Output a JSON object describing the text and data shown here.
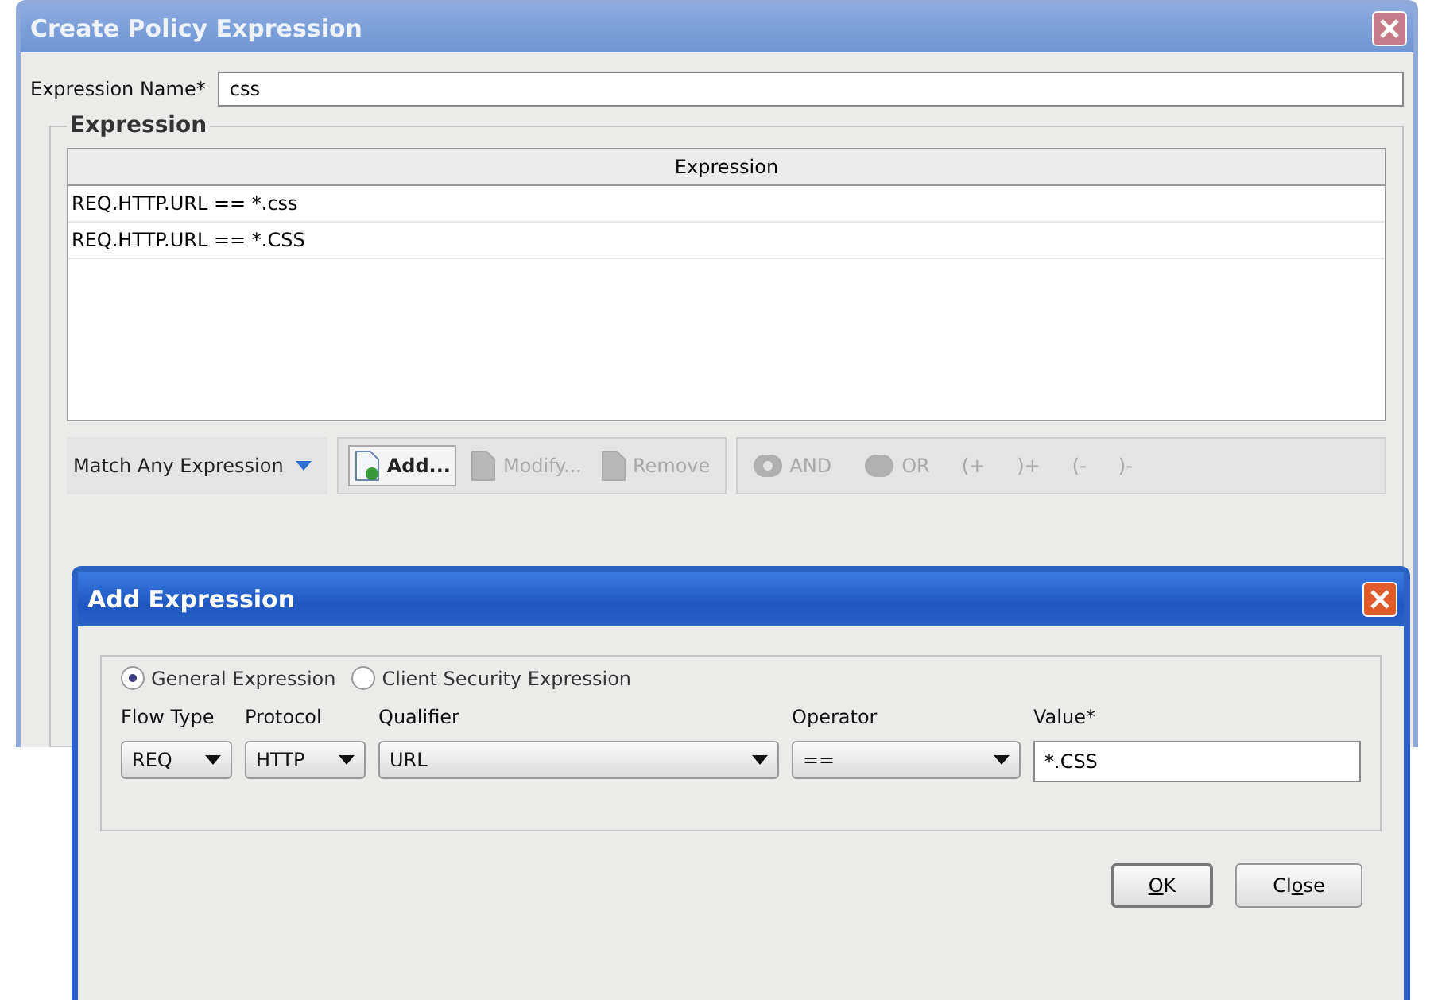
{
  "main_window": {
    "title": "Create Policy Expression",
    "name_field": {
      "label": "Expression Name*",
      "value": "css"
    },
    "group": {
      "legend": "Expression",
      "table": {
        "columns": [
          "Expression"
        ],
        "rows": [
          "REQ.HTTP.URL == *.css",
          "REQ.HTTP.URL == *.CSS"
        ]
      }
    },
    "match_button": "Match Any Expression",
    "actions": [
      {
        "label": "Add...",
        "disabled": false
      },
      {
        "label": "Modify...",
        "disabled": true
      },
      {
        "label": "Remove",
        "disabled": true
      }
    ],
    "operators": [
      {
        "label": "AND",
        "kind": "and",
        "disabled": true
      },
      {
        "label": "OR",
        "kind": "or",
        "disabled": true
      },
      {
        "label": "(+",
        "kind": "text",
        "disabled": true
      },
      {
        "label": ")+",
        "kind": "text",
        "disabled": true
      },
      {
        "label": "(-",
        "kind": "text",
        "disabled": true
      },
      {
        "label": ")-",
        "kind": "text",
        "disabled": true
      }
    ]
  },
  "dialog": {
    "title": "Add Expression",
    "radios": [
      {
        "label": "General Expression",
        "selected": true
      },
      {
        "label": "Client Security Expression",
        "selected": false
      }
    ],
    "fields": [
      {
        "label": "Flow Type",
        "kind": "select",
        "value": "REQ"
      },
      {
        "label": "Protocol",
        "kind": "select",
        "value": "HTTP"
      },
      {
        "label": "Qualifier",
        "kind": "select",
        "value": "URL"
      },
      {
        "label": "Operator",
        "kind": "select",
        "value": "=="
      },
      {
        "label": "Value*",
        "kind": "text",
        "value": "*.CSS"
      }
    ],
    "buttons": [
      {
        "key": "O",
        "after": "K"
      },
      {
        "before": "Cl",
        "key": "o",
        "after": "se"
      }
    ]
  }
}
